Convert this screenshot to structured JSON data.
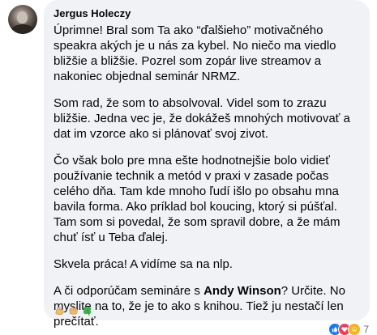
{
  "comment": {
    "author": "Jergus Holeczy",
    "paragraphs": [
      {
        "text": "Úprimne! Bral som Ta ako “ďalšieho” motivačného speakra akých je u nás za kybel. No niečo ma viedlo bližšie a bližšie. Pozrel som zopár live streamov a nakoniec objednal seminár NRMZ."
      },
      {
        "text": "Som rad, že som to absolvoval. Videl som to zrazu bližšie. Jedna vec je, že dokážeš mnohých motivovať a dat im vzorce ako si plánovať svoj zivot."
      },
      {
        "text": "Čo však bolo pre mna ešte hodnotnejšie bolo vidieť používanie technik a metód v praxi v zasade počas celého dňa. Tam kde mnoho ľudí išlo po obsahu mna bavila forma. Ako príklad bol koucing, ktorý si púšťal. Tam som si povedal, že som spravil dobre, a že mám chuť ísť u Teba ďalej."
      },
      {
        "text": "Skvela práca! A vidíme sa na nlp."
      }
    ],
    "last_paragraph": {
      "before": "A či odporúčam semináre s ",
      "bold": "Andy Winson",
      "after": "? Určite. No myslite na to, že je to ako s knihou. Tiež ju nestačí len prečítať."
    },
    "emojis": [
      "muscle-emoji",
      "fist-emoji",
      "four-leaf-clover-emoji"
    ],
    "reactions": {
      "icons": [
        "like-icon",
        "love-icon",
        "care-icon"
      ],
      "count": "7"
    }
  }
}
